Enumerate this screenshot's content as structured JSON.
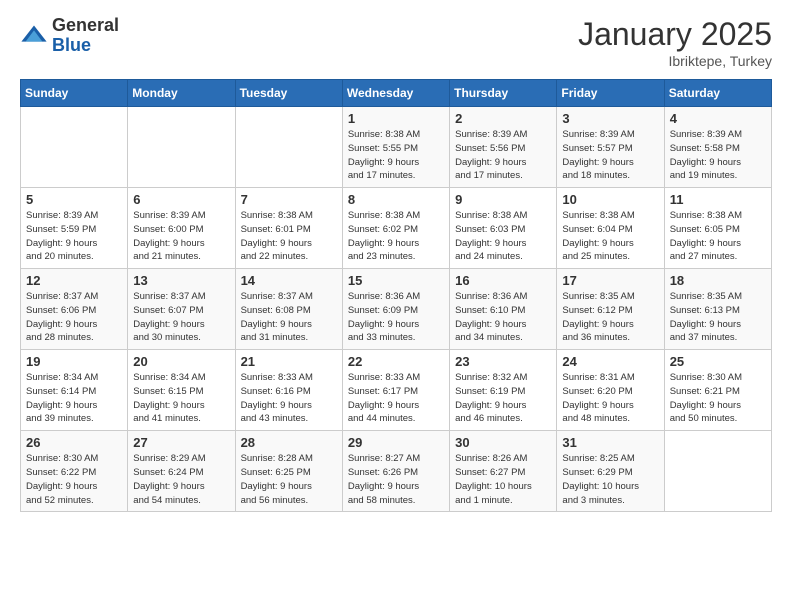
{
  "logo": {
    "general": "General",
    "blue": "Blue"
  },
  "header": {
    "month": "January 2025",
    "location": "Ibriktepe, Turkey"
  },
  "weekdays": [
    "Sunday",
    "Monday",
    "Tuesday",
    "Wednesday",
    "Thursday",
    "Friday",
    "Saturday"
  ],
  "weeks": [
    [
      {
        "day": "",
        "info": ""
      },
      {
        "day": "",
        "info": ""
      },
      {
        "day": "",
        "info": ""
      },
      {
        "day": "1",
        "info": "Sunrise: 8:38 AM\nSunset: 5:55 PM\nDaylight: 9 hours\nand 17 minutes."
      },
      {
        "day": "2",
        "info": "Sunrise: 8:39 AM\nSunset: 5:56 PM\nDaylight: 9 hours\nand 17 minutes."
      },
      {
        "day": "3",
        "info": "Sunrise: 8:39 AM\nSunset: 5:57 PM\nDaylight: 9 hours\nand 18 minutes."
      },
      {
        "day": "4",
        "info": "Sunrise: 8:39 AM\nSunset: 5:58 PM\nDaylight: 9 hours\nand 19 minutes."
      }
    ],
    [
      {
        "day": "5",
        "info": "Sunrise: 8:39 AM\nSunset: 5:59 PM\nDaylight: 9 hours\nand 20 minutes."
      },
      {
        "day": "6",
        "info": "Sunrise: 8:39 AM\nSunset: 6:00 PM\nDaylight: 9 hours\nand 21 minutes."
      },
      {
        "day": "7",
        "info": "Sunrise: 8:38 AM\nSunset: 6:01 PM\nDaylight: 9 hours\nand 22 minutes."
      },
      {
        "day": "8",
        "info": "Sunrise: 8:38 AM\nSunset: 6:02 PM\nDaylight: 9 hours\nand 23 minutes."
      },
      {
        "day": "9",
        "info": "Sunrise: 8:38 AM\nSunset: 6:03 PM\nDaylight: 9 hours\nand 24 minutes."
      },
      {
        "day": "10",
        "info": "Sunrise: 8:38 AM\nSunset: 6:04 PM\nDaylight: 9 hours\nand 25 minutes."
      },
      {
        "day": "11",
        "info": "Sunrise: 8:38 AM\nSunset: 6:05 PM\nDaylight: 9 hours\nand 27 minutes."
      }
    ],
    [
      {
        "day": "12",
        "info": "Sunrise: 8:37 AM\nSunset: 6:06 PM\nDaylight: 9 hours\nand 28 minutes."
      },
      {
        "day": "13",
        "info": "Sunrise: 8:37 AM\nSunset: 6:07 PM\nDaylight: 9 hours\nand 30 minutes."
      },
      {
        "day": "14",
        "info": "Sunrise: 8:37 AM\nSunset: 6:08 PM\nDaylight: 9 hours\nand 31 minutes."
      },
      {
        "day": "15",
        "info": "Sunrise: 8:36 AM\nSunset: 6:09 PM\nDaylight: 9 hours\nand 33 minutes."
      },
      {
        "day": "16",
        "info": "Sunrise: 8:36 AM\nSunset: 6:10 PM\nDaylight: 9 hours\nand 34 minutes."
      },
      {
        "day": "17",
        "info": "Sunrise: 8:35 AM\nSunset: 6:12 PM\nDaylight: 9 hours\nand 36 minutes."
      },
      {
        "day": "18",
        "info": "Sunrise: 8:35 AM\nSunset: 6:13 PM\nDaylight: 9 hours\nand 37 minutes."
      }
    ],
    [
      {
        "day": "19",
        "info": "Sunrise: 8:34 AM\nSunset: 6:14 PM\nDaylight: 9 hours\nand 39 minutes."
      },
      {
        "day": "20",
        "info": "Sunrise: 8:34 AM\nSunset: 6:15 PM\nDaylight: 9 hours\nand 41 minutes."
      },
      {
        "day": "21",
        "info": "Sunrise: 8:33 AM\nSunset: 6:16 PM\nDaylight: 9 hours\nand 43 minutes."
      },
      {
        "day": "22",
        "info": "Sunrise: 8:33 AM\nSunset: 6:17 PM\nDaylight: 9 hours\nand 44 minutes."
      },
      {
        "day": "23",
        "info": "Sunrise: 8:32 AM\nSunset: 6:19 PM\nDaylight: 9 hours\nand 46 minutes."
      },
      {
        "day": "24",
        "info": "Sunrise: 8:31 AM\nSunset: 6:20 PM\nDaylight: 9 hours\nand 48 minutes."
      },
      {
        "day": "25",
        "info": "Sunrise: 8:30 AM\nSunset: 6:21 PM\nDaylight: 9 hours\nand 50 minutes."
      }
    ],
    [
      {
        "day": "26",
        "info": "Sunrise: 8:30 AM\nSunset: 6:22 PM\nDaylight: 9 hours\nand 52 minutes."
      },
      {
        "day": "27",
        "info": "Sunrise: 8:29 AM\nSunset: 6:24 PM\nDaylight: 9 hours\nand 54 minutes."
      },
      {
        "day": "28",
        "info": "Sunrise: 8:28 AM\nSunset: 6:25 PM\nDaylight: 9 hours\nand 56 minutes."
      },
      {
        "day": "29",
        "info": "Sunrise: 8:27 AM\nSunset: 6:26 PM\nDaylight: 9 hours\nand 58 minutes."
      },
      {
        "day": "30",
        "info": "Sunrise: 8:26 AM\nSunset: 6:27 PM\nDaylight: 10 hours\nand 1 minute."
      },
      {
        "day": "31",
        "info": "Sunrise: 8:25 AM\nSunset: 6:29 PM\nDaylight: 10 hours\nand 3 minutes."
      },
      {
        "day": "",
        "info": ""
      }
    ]
  ]
}
